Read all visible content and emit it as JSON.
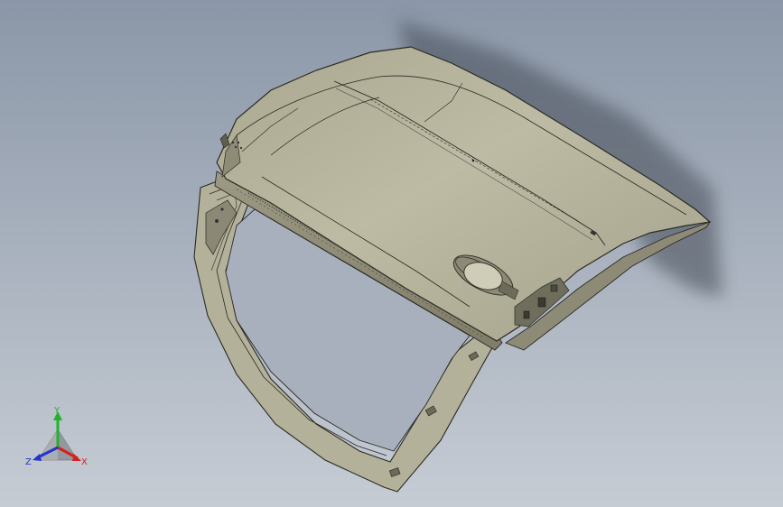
{
  "viewport": {
    "background_top": "#8b97a8",
    "background_bottom": "#c6ccd4",
    "model_color": "#b5b39b",
    "edge_color": "#2a2a24"
  },
  "triad": {
    "x_label": "X",
    "y_label": "Y",
    "z_label": "Z",
    "x_color": "#d32020",
    "y_color": "#1fb52a",
    "z_color": "#2233d0"
  }
}
